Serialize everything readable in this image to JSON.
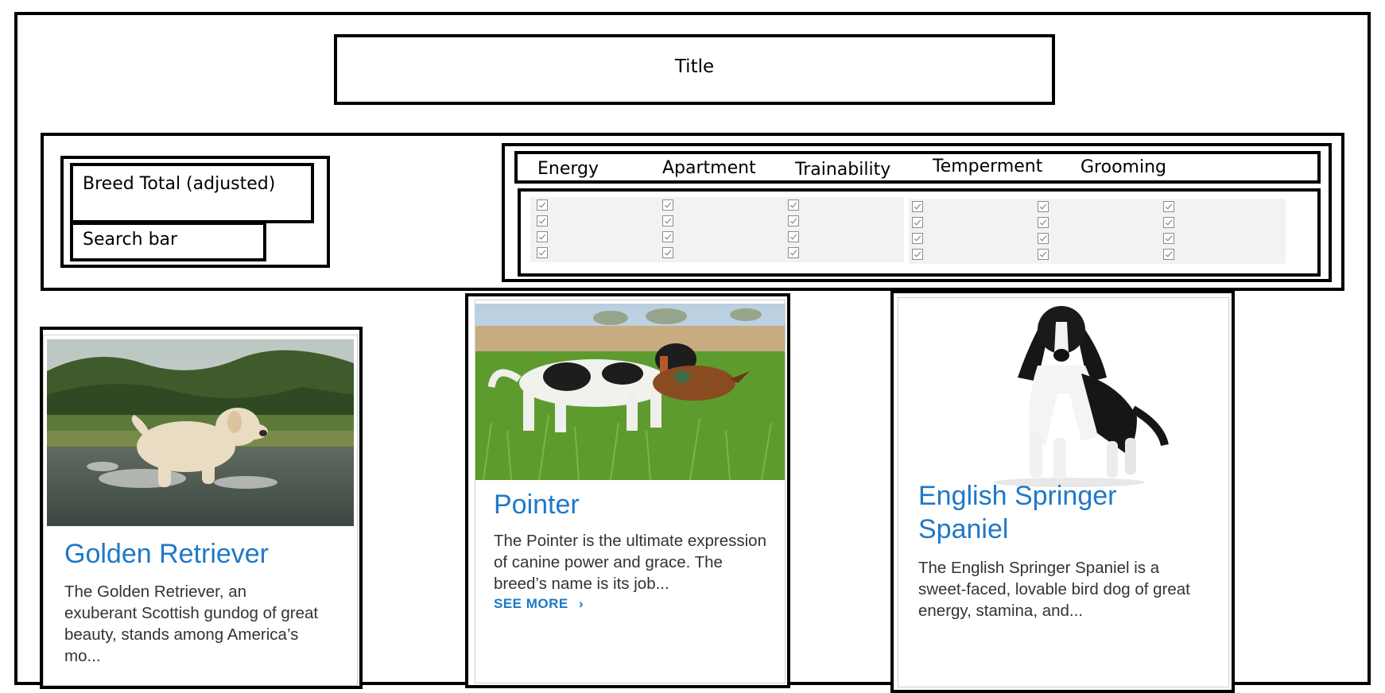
{
  "header": {
    "title": "Title"
  },
  "controls": {
    "breed_total_label": "Breed Total (adjusted)",
    "search_label": "Search bar"
  },
  "filters": {
    "headers": [
      "Energy",
      "Apartment",
      "Trainability",
      "Temperment",
      "Grooming"
    ],
    "checkbox_columns": 6,
    "checkboxes_per_column": 4
  },
  "cards": [
    {
      "name": "Golden Retriever",
      "description": "The Golden Retriever, an exuberant Scottish gundog of great beauty, stands among America’s mo...",
      "image": "golden-retriever-in-water-photo"
    },
    {
      "name": "Pointer",
      "description": "The Pointer is the ultimate expression of canine power and grace. The breed’s name is its job...",
      "link": "SEE MORE",
      "image": "pointer-dog-in-grass-photo"
    },
    {
      "name": "English Springer Spaniel",
      "description": "The English Springer Spaniel is a sweet-faced, lovable bird dog of great energy, stamina, and...",
      "image": "english-springer-spaniel-photo"
    }
  ],
  "colors": {
    "link": "#1f78c8",
    "border": "#000000",
    "checkbox_bg": "#f2f2f2"
  }
}
